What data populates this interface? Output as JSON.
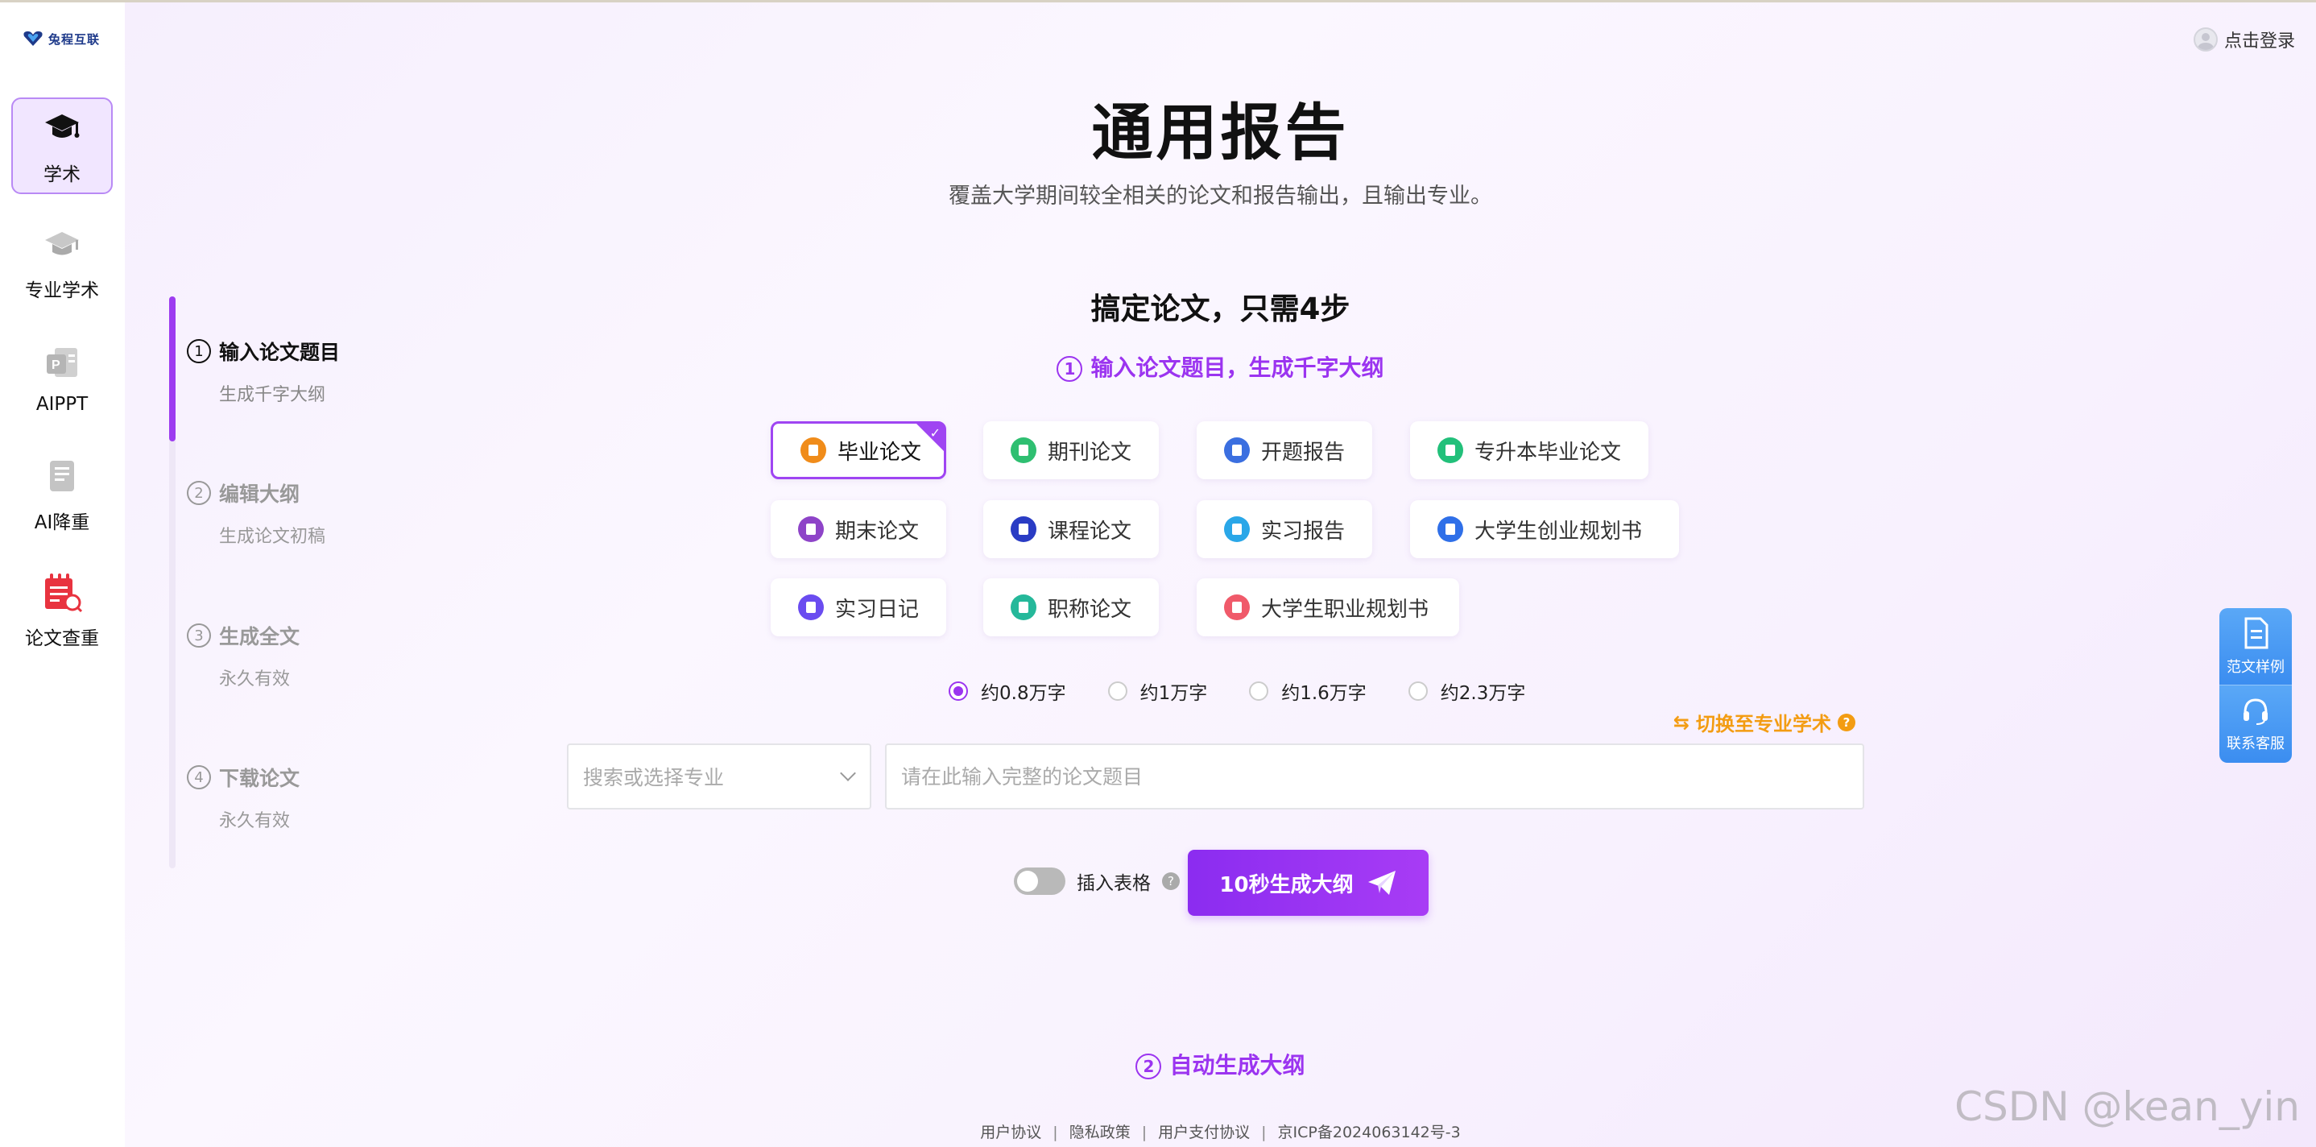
{
  "brand": {
    "name": "兔程互联"
  },
  "nav": {
    "items": [
      {
        "label": "学术",
        "icon": "mortarboard-icon",
        "active": true
      },
      {
        "label": "专业学术",
        "icon": "graduation-cap-icon"
      },
      {
        "label": "AIPPT",
        "icon": "ppt-icon"
      },
      {
        "label": "AI降重",
        "icon": "document-icon"
      },
      {
        "label": "论文查重",
        "icon": "plagiarism-check-icon"
      }
    ]
  },
  "header": {
    "login": "点击登录"
  },
  "hero": {
    "title": "通用报告",
    "subtitle": "覆盖大学期间较全相关的论文和报告输出，且输出专业。"
  },
  "steps": [
    {
      "num": "1",
      "title": "输入论文题目",
      "desc": "生成千字大纲",
      "active": true
    },
    {
      "num": "2",
      "title": "编辑大纲",
      "desc": "生成论文初稿"
    },
    {
      "num": "3",
      "title": "生成全文",
      "desc": "永久有效"
    },
    {
      "num": "4",
      "title": "下载论文",
      "desc": "永久有效"
    }
  ],
  "section": {
    "title": "搞定论文，只需4步",
    "step1_num": "1",
    "step1_hint": "输入论文题目，生成千字大纲",
    "step2_num": "2",
    "step2_hint": "自动生成大纲"
  },
  "paper_types": [
    {
      "label": "毕业论文",
      "color": "#f08c1a",
      "selected": true
    },
    {
      "label": "期刊论文",
      "color": "#2fbf71"
    },
    {
      "label": "开题报告",
      "color": "#3b6fe0"
    },
    {
      "label": "专升本毕业论文",
      "color": "#22c07a"
    },
    {
      "label": "期末论文",
      "color": "#8e44c8"
    },
    {
      "label": "课程论文",
      "color": "#2a3cc4"
    },
    {
      "label": "实习报告",
      "color": "#2aa7e8"
    },
    {
      "label": "大学生创业规划书",
      "color": "#2f6fe8"
    },
    {
      "label": "实习日记",
      "color": "#6a4cf0"
    },
    {
      "label": "职称论文",
      "color": "#25b89a"
    },
    {
      "label": "大学生职业规划书",
      "color": "#f05a6a"
    }
  ],
  "word_counts": {
    "options": [
      "约0.8万字",
      "约1万字",
      "约1.6万字",
      "约2.3万字"
    ],
    "selected": "约0.8万字"
  },
  "switch_pro": {
    "label": "切换至专业学术",
    "help": "?"
  },
  "form": {
    "major_placeholder": "搜索或选择专业",
    "topic_placeholder": "请在此输入完整的论文题目"
  },
  "table_toggle": {
    "label": "插入表格",
    "help": "?",
    "on": false
  },
  "generate_button": "10秒生成大纲",
  "float_panel": {
    "sample": "范文样例",
    "service": "联系客服"
  },
  "footer": {
    "links": [
      "用户协议",
      "隐私政策",
      "用户支付协议",
      "京ICP备2024063142号-3"
    ]
  },
  "watermark": "CSDN @kean_yin",
  "colors": {
    "accent": "#9b34f0",
    "warning": "#f39c12",
    "float_blue": "#3b8df0"
  }
}
